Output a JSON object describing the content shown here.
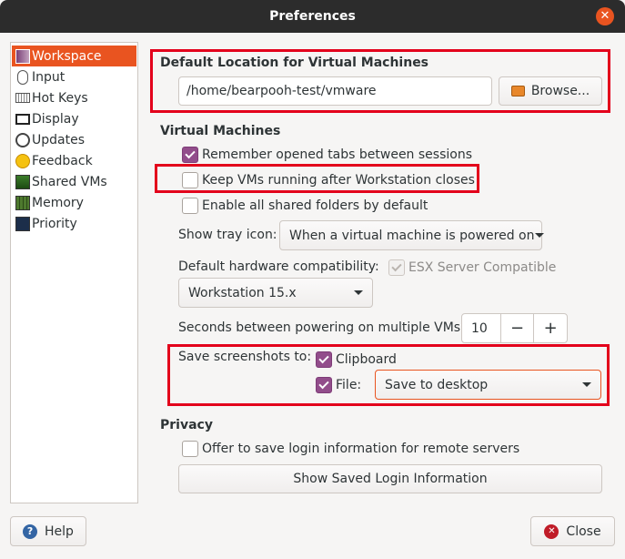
{
  "window": {
    "title": "Preferences"
  },
  "sidebar": {
    "items": [
      {
        "label": "Workspace",
        "icon": "workspace-icon",
        "selected": true
      },
      {
        "label": "Input",
        "icon": "mouse-icon"
      },
      {
        "label": "Hot Keys",
        "icon": "keyboard-icon"
      },
      {
        "label": "Display",
        "icon": "monitor-icon"
      },
      {
        "label": "Updates",
        "icon": "updates-icon"
      },
      {
        "label": "Feedback",
        "icon": "feedback-icon"
      },
      {
        "label": "Shared VMs",
        "icon": "shared-vms-icon"
      },
      {
        "label": "Memory",
        "icon": "memory-icon"
      },
      {
        "label": "Priority",
        "icon": "priority-icon"
      }
    ]
  },
  "default_location": {
    "heading": "Default Location for Virtual Machines",
    "path": "/home/bearpooh-test/vmware",
    "browse_label": "Browse..."
  },
  "virtual_machines": {
    "heading": "Virtual Machines",
    "remember_tabs": {
      "label": "Remember opened tabs between sessions",
      "checked": true
    },
    "keep_running": {
      "label": "Keep VMs running after Workstation closes",
      "checked": false
    },
    "shared_folders": {
      "label": "Enable all shared folders by default",
      "checked": false
    },
    "tray_icon_label": "Show tray icon:",
    "tray_icon_value": "When a virtual machine is powered on",
    "hw_compat_label": "Default hardware compatibility:",
    "esx_label": "ESX Server Compatible",
    "hw_compat_value": "Workstation 15.x",
    "seconds_label": "Seconds between powering on multiple VMs:",
    "seconds_value": "10",
    "minus": "−",
    "plus": "+",
    "screenshots_label": "Save screenshots to:",
    "clipboard_label": "Clipboard",
    "file_label": "File:",
    "file_value": "Save to desktop"
  },
  "privacy": {
    "heading": "Privacy",
    "offer_label": "Offer to save login information for remote servers",
    "show_saved_label": "Show Saved Login Information"
  },
  "footer": {
    "help_label": "Help",
    "close_label": "Close"
  },
  "colors": {
    "accent": "#e95420",
    "checkbox": "#924d8b",
    "highlight": "#e3001b"
  }
}
